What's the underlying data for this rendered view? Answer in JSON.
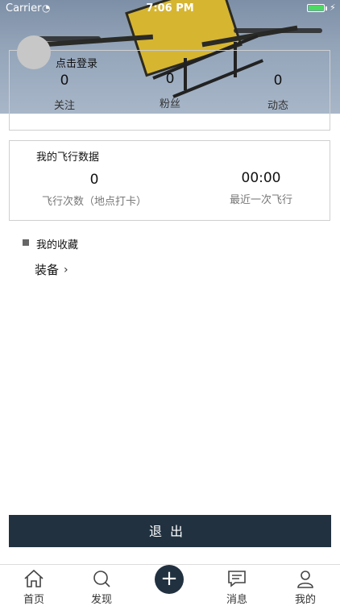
{
  "status_bar": {
    "carrier": "Carrier",
    "time": "7:06 PM",
    "battery_level": 1.0
  },
  "profile": {
    "login_prompt": "点击登录",
    "stats": [
      {
        "value": "0",
        "label": "关注"
      },
      {
        "value": "0",
        "label": "粉丝"
      },
      {
        "value": "0",
        "label": "动态"
      }
    ]
  },
  "flight_data": {
    "title": "我的飞行数据",
    "count_value": "0",
    "count_label": "飞行次数（地点打卡）",
    "last_value": "00:00",
    "last_label": "最近一次飞行"
  },
  "favorites": {
    "title": "我的收藏",
    "equipment_label": "装备"
  },
  "logout_label": "退出",
  "tabs": [
    {
      "label": "首页",
      "icon": "home-icon"
    },
    {
      "label": "发现",
      "icon": "discover-icon"
    },
    {
      "label": "",
      "icon": "plus-icon"
    },
    {
      "label": "消息",
      "icon": "message-icon"
    },
    {
      "label": "我的",
      "icon": "profile-icon"
    }
  ],
  "colors": {
    "accent": "#213140",
    "battery": "#4cd964"
  }
}
